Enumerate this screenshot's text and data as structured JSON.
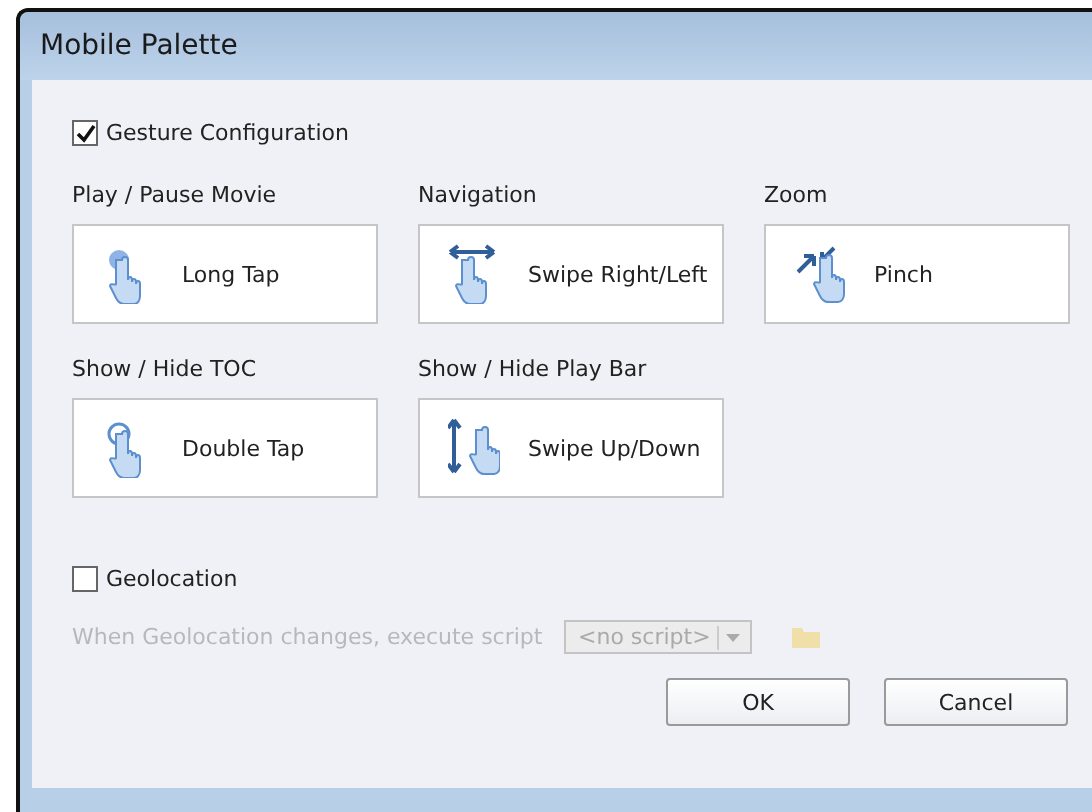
{
  "window": {
    "title": "Mobile Palette"
  },
  "gesture_configuration": {
    "label": "Gesture Configuration",
    "checked": true
  },
  "gestures": [
    {
      "label": "Play / Pause Movie",
      "gesture": "Long Tap",
      "kind": "long-tap"
    },
    {
      "label": "Navigation",
      "gesture": "Swipe Right/Left",
      "kind": "swipe-horizontal"
    },
    {
      "label": "Zoom",
      "gesture": "Pinch",
      "kind": "pinch"
    },
    {
      "label": "Show / Hide TOC",
      "gesture": "Double Tap",
      "kind": "double-tap"
    },
    {
      "label": "Show / Hide Play Bar",
      "gesture": "Swipe Up/Down",
      "kind": "swipe-vertical"
    }
  ],
  "geolocation": {
    "label": "Geolocation",
    "checked": false
  },
  "script_row": {
    "label": "When Geolocation changes, execute script",
    "value": "<no script>",
    "disabled": true
  },
  "buttons": [
    "OK",
    "Cancel"
  ]
}
